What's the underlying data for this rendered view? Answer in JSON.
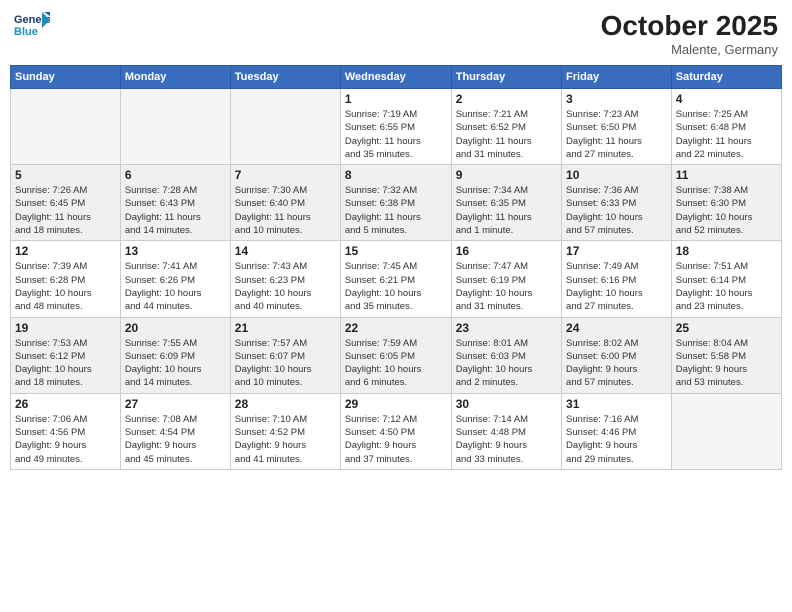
{
  "header": {
    "logo_line1": "General",
    "logo_line2": "Blue",
    "month": "October 2025",
    "location": "Malente, Germany"
  },
  "weekdays": [
    "Sunday",
    "Monday",
    "Tuesday",
    "Wednesday",
    "Thursday",
    "Friday",
    "Saturday"
  ],
  "weeks": [
    [
      {
        "day": "",
        "info": ""
      },
      {
        "day": "",
        "info": ""
      },
      {
        "day": "",
        "info": ""
      },
      {
        "day": "1",
        "info": "Sunrise: 7:19 AM\nSunset: 6:55 PM\nDaylight: 11 hours\nand 35 minutes."
      },
      {
        "day": "2",
        "info": "Sunrise: 7:21 AM\nSunset: 6:52 PM\nDaylight: 11 hours\nand 31 minutes."
      },
      {
        "day": "3",
        "info": "Sunrise: 7:23 AM\nSunset: 6:50 PM\nDaylight: 11 hours\nand 27 minutes."
      },
      {
        "day": "4",
        "info": "Sunrise: 7:25 AM\nSunset: 6:48 PM\nDaylight: 11 hours\nand 22 minutes."
      }
    ],
    [
      {
        "day": "5",
        "info": "Sunrise: 7:26 AM\nSunset: 6:45 PM\nDaylight: 11 hours\nand 18 minutes."
      },
      {
        "day": "6",
        "info": "Sunrise: 7:28 AM\nSunset: 6:43 PM\nDaylight: 11 hours\nand 14 minutes."
      },
      {
        "day": "7",
        "info": "Sunrise: 7:30 AM\nSunset: 6:40 PM\nDaylight: 11 hours\nand 10 minutes."
      },
      {
        "day": "8",
        "info": "Sunrise: 7:32 AM\nSunset: 6:38 PM\nDaylight: 11 hours\nand 5 minutes."
      },
      {
        "day": "9",
        "info": "Sunrise: 7:34 AM\nSunset: 6:35 PM\nDaylight: 11 hours\nand 1 minute."
      },
      {
        "day": "10",
        "info": "Sunrise: 7:36 AM\nSunset: 6:33 PM\nDaylight: 10 hours\nand 57 minutes."
      },
      {
        "day": "11",
        "info": "Sunrise: 7:38 AM\nSunset: 6:30 PM\nDaylight: 10 hours\nand 52 minutes."
      }
    ],
    [
      {
        "day": "12",
        "info": "Sunrise: 7:39 AM\nSunset: 6:28 PM\nDaylight: 10 hours\nand 48 minutes."
      },
      {
        "day": "13",
        "info": "Sunrise: 7:41 AM\nSunset: 6:26 PM\nDaylight: 10 hours\nand 44 minutes."
      },
      {
        "day": "14",
        "info": "Sunrise: 7:43 AM\nSunset: 6:23 PM\nDaylight: 10 hours\nand 40 minutes."
      },
      {
        "day": "15",
        "info": "Sunrise: 7:45 AM\nSunset: 6:21 PM\nDaylight: 10 hours\nand 35 minutes."
      },
      {
        "day": "16",
        "info": "Sunrise: 7:47 AM\nSunset: 6:19 PM\nDaylight: 10 hours\nand 31 minutes."
      },
      {
        "day": "17",
        "info": "Sunrise: 7:49 AM\nSunset: 6:16 PM\nDaylight: 10 hours\nand 27 minutes."
      },
      {
        "day": "18",
        "info": "Sunrise: 7:51 AM\nSunset: 6:14 PM\nDaylight: 10 hours\nand 23 minutes."
      }
    ],
    [
      {
        "day": "19",
        "info": "Sunrise: 7:53 AM\nSunset: 6:12 PM\nDaylight: 10 hours\nand 18 minutes."
      },
      {
        "day": "20",
        "info": "Sunrise: 7:55 AM\nSunset: 6:09 PM\nDaylight: 10 hours\nand 14 minutes."
      },
      {
        "day": "21",
        "info": "Sunrise: 7:57 AM\nSunset: 6:07 PM\nDaylight: 10 hours\nand 10 minutes."
      },
      {
        "day": "22",
        "info": "Sunrise: 7:59 AM\nSunset: 6:05 PM\nDaylight: 10 hours\nand 6 minutes."
      },
      {
        "day": "23",
        "info": "Sunrise: 8:01 AM\nSunset: 6:03 PM\nDaylight: 10 hours\nand 2 minutes."
      },
      {
        "day": "24",
        "info": "Sunrise: 8:02 AM\nSunset: 6:00 PM\nDaylight: 9 hours\nand 57 minutes."
      },
      {
        "day": "25",
        "info": "Sunrise: 8:04 AM\nSunset: 5:58 PM\nDaylight: 9 hours\nand 53 minutes."
      }
    ],
    [
      {
        "day": "26",
        "info": "Sunrise: 7:06 AM\nSunset: 4:56 PM\nDaylight: 9 hours\nand 49 minutes."
      },
      {
        "day": "27",
        "info": "Sunrise: 7:08 AM\nSunset: 4:54 PM\nDaylight: 9 hours\nand 45 minutes."
      },
      {
        "day": "28",
        "info": "Sunrise: 7:10 AM\nSunset: 4:52 PM\nDaylight: 9 hours\nand 41 minutes."
      },
      {
        "day": "29",
        "info": "Sunrise: 7:12 AM\nSunset: 4:50 PM\nDaylight: 9 hours\nand 37 minutes."
      },
      {
        "day": "30",
        "info": "Sunrise: 7:14 AM\nSunset: 4:48 PM\nDaylight: 9 hours\nand 33 minutes."
      },
      {
        "day": "31",
        "info": "Sunrise: 7:16 AM\nSunset: 4:46 PM\nDaylight: 9 hours\nand 29 minutes."
      },
      {
        "day": "",
        "info": ""
      }
    ]
  ]
}
